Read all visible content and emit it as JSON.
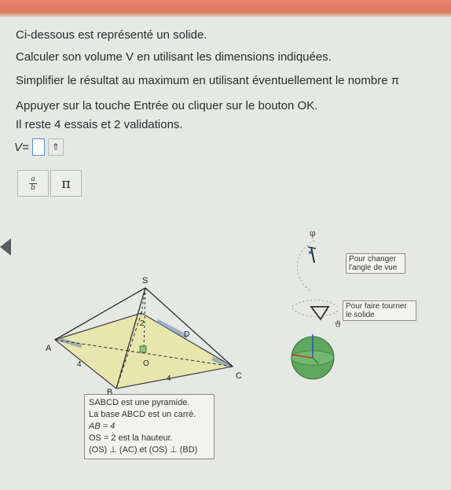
{
  "instructions": {
    "line1": "Ci-dessous est représenté un solide.",
    "line2": "Calculer son volume V en utilisant les dimensions indiquées.",
    "line3": "Simplifier le résultat au maximum en utilisant éventuellement le nombre π",
    "line4": "Appuyer sur la touche Entrée ou cliquer sur le bouton OK.",
    "line5": "Il reste 4 essais et 2 validations."
  },
  "answer": {
    "lhs": "V=",
    "value": "",
    "cursor_glyph": "⇑"
  },
  "toolbar": {
    "fraction_num": "a",
    "fraction_den": "b",
    "pi_label": "π"
  },
  "viewer": {
    "phi_label": "φ",
    "theta_label": "ϑ",
    "tip_change_view": "Pour changer l'angle de vue",
    "tip_rotate": "Pour faire tourner le solide"
  },
  "figure": {
    "label_S": "S",
    "label_A": "A",
    "label_B": "B",
    "label_C": "C",
    "label_D": "D",
    "label_O": "O",
    "label_SO": "2",
    "label_AB": "4",
    "label_BC": "4"
  },
  "caption": {
    "line1": "SABCD est une pyramide.",
    "line2": "La base ABCD est un carré.",
    "line3": "AB = 4",
    "line4": "OS = 2 est la hauteur.",
    "line5": "(OS) ⊥ (AC) et (OS) ⊥ (BD)"
  },
  "colors": {
    "banner": "#e07a5f",
    "base_fill": "#e8e6a6",
    "edge": "#2b2d33",
    "sphere": "#5ea75e",
    "answer_border": "#5a8fd0"
  }
}
